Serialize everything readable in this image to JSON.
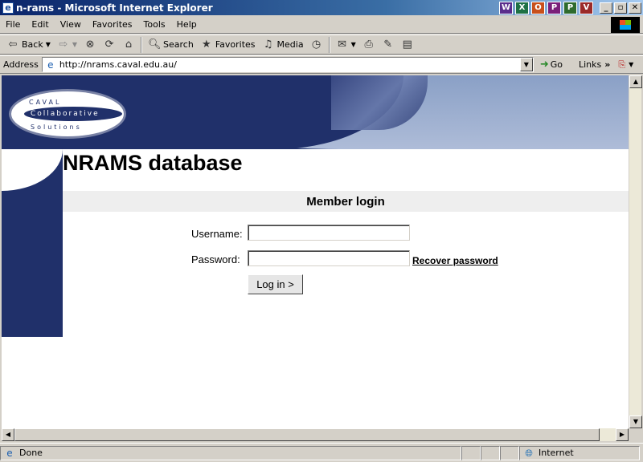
{
  "window": {
    "title": "n-rams - Microsoft Internet Explorer",
    "tray_icons": [
      "W",
      "X",
      "O",
      "P",
      "Pr",
      "Vi"
    ]
  },
  "menu": {
    "items": [
      {
        "label": "File",
        "key": "F"
      },
      {
        "label": "Edit",
        "key": "E"
      },
      {
        "label": "View",
        "key": "V"
      },
      {
        "label": "Favorites",
        "key": "a"
      },
      {
        "label": "Tools",
        "key": "T"
      },
      {
        "label": "Help",
        "key": "H"
      }
    ]
  },
  "toolbar": {
    "back": "Back",
    "search": "Search",
    "favorites": "Favorites",
    "media": "Media"
  },
  "address": {
    "label": "Address",
    "url": "http://nrams.caval.edu.au/",
    "go": "Go",
    "links": "Links"
  },
  "page": {
    "logo": {
      "top": "CAVAL",
      "middle": "Collaborative",
      "bottom": "Solutions"
    },
    "title": "NRAMS database",
    "section": "Member login",
    "username_label": "Username:",
    "password_label": "Password:",
    "username_value": "",
    "password_value": "",
    "recover_link": "Recover password",
    "login_button": "Log in >"
  },
  "status": {
    "text": "Done",
    "zone": "Internet"
  },
  "colors": {
    "brand_navy": "#20306a",
    "banner_light": "#8aa0c6",
    "strip_grey": "#eeeeee"
  }
}
